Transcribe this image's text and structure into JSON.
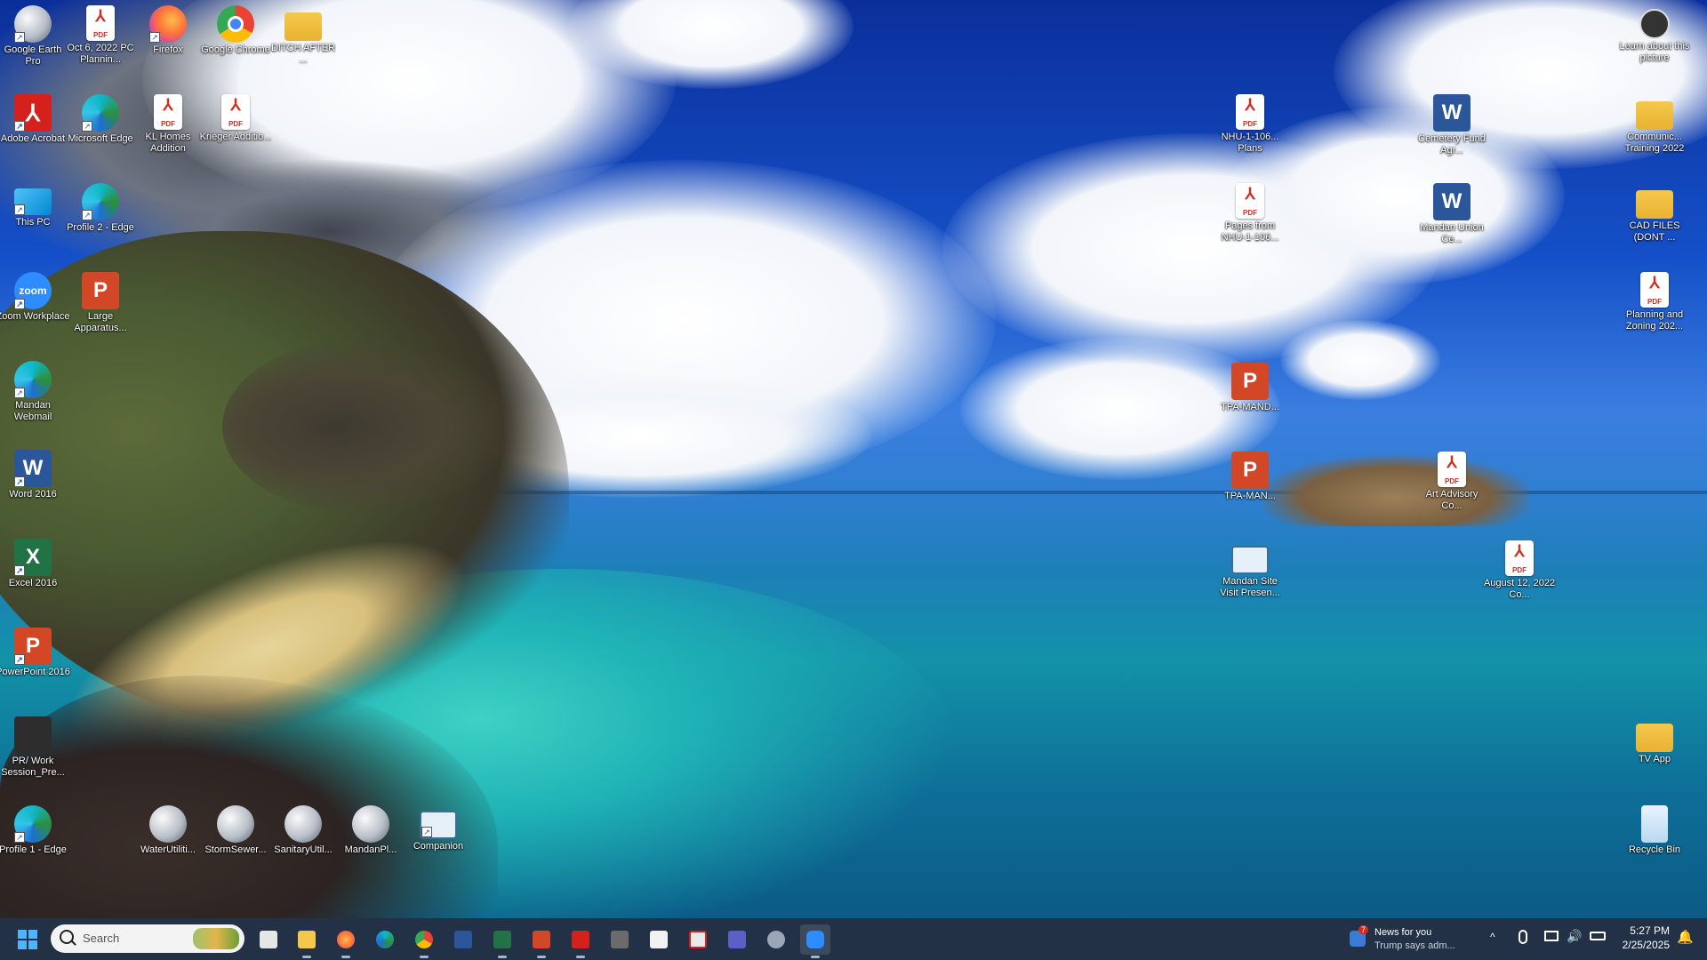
{
  "desktop_icons": {
    "col1": [
      {
        "label": "Google Earth Pro",
        "icon": "google-earth-icon"
      },
      {
        "label": "Adobe Acrobat",
        "icon": "acrobat-icon"
      },
      {
        "label": "This PC",
        "icon": "this-pc-icon"
      },
      {
        "label": "Zoom Workplace",
        "icon": "zoom-icon"
      },
      {
        "label": "Mandan Webmail",
        "icon": "edge-icon"
      },
      {
        "label": "Word 2016",
        "icon": "word-icon"
      },
      {
        "label": "Excel 2016",
        "icon": "excel-icon"
      },
      {
        "label": "PowerPoint 2016",
        "icon": "powerpoint-icon"
      },
      {
        "label": "PR/ Work Session_Pre...",
        "icon": "presentation-icon"
      },
      {
        "label": "Profile 1 - Edge",
        "icon": "edge-icon"
      }
    ],
    "col2": [
      {
        "label": "Oct 6, 2022 PC Plannin...",
        "icon": "pdf-icon"
      },
      {
        "label": "Microsoft Edge",
        "icon": "edge-icon"
      },
      {
        "label": "Profile 2 - Edge",
        "icon": "edge-icon"
      },
      {
        "label": "Large Apparatus...",
        "icon": "powerpoint-icon"
      }
    ],
    "col3": [
      {
        "label": "Firefox",
        "icon": "firefox-icon"
      },
      {
        "label": "KL Homes Addition",
        "icon": "pdf-icon"
      }
    ],
    "col4": [
      {
        "label": "Google Chrome",
        "icon": "chrome-icon"
      },
      {
        "label": "Krieger Additio...",
        "icon": "pdf-icon"
      }
    ],
    "col5": [
      {
        "label": "DITCH AFTER ...",
        "icon": "folder-icon"
      }
    ],
    "bottom_row": [
      {
        "label": "WaterUtiliti...",
        "icon": "google-earth-icon"
      },
      {
        "label": "StormSewer...",
        "icon": "google-earth-icon"
      },
      {
        "label": "SanitaryUtil...",
        "icon": "google-earth-icon"
      },
      {
        "label": "MandanPl...",
        "icon": "google-earth-icon"
      },
      {
        "label": "Companion",
        "icon": "companion-icon"
      }
    ],
    "right_a": [
      {
        "label": "NHU-1-106... Plans",
        "icon": "pdf-icon"
      },
      {
        "label": "Pages from NHU-1-106...",
        "icon": "pdf-icon"
      },
      {
        "label": "TPA-MAND...",
        "icon": "powerpoint-icon"
      },
      {
        "label": "TPA-MAN...",
        "icon": "powerpoint-icon"
      },
      {
        "label": "Mandan Site Visit Presen...",
        "icon": "presentation-icon"
      }
    ],
    "right_b": [
      {
        "label": "Cemetery Fund Agr...",
        "icon": "word-icon"
      },
      {
        "label": "Mandan Union Ce...",
        "icon": "word-icon"
      },
      {
        "label": "Art Advisory Co...",
        "icon": "pdf-icon"
      }
    ],
    "right_c": [
      {
        "label": "August 12, 2022 Co...",
        "icon": "pdf-icon"
      }
    ],
    "right_d": [
      {
        "label": "Learn about this picture",
        "icon": "info-icon"
      },
      {
        "label": "Communic... Training 2022",
        "icon": "folder-icon"
      },
      {
        "label": "CAD FILES (DONT ...",
        "icon": "folder-icon"
      },
      {
        "label": "Planning and Zoning 202...",
        "icon": "pdf-icon"
      },
      {
        "label": "TV App",
        "icon": "folder-icon"
      },
      {
        "label": "Recycle Bin",
        "icon": "recycle-bin-icon"
      }
    ]
  },
  "taskbar": {
    "search_placeholder": "Search",
    "apps": [
      "task-view-icon",
      "file-explorer-icon",
      "firefox-icon",
      "edge-icon",
      "chrome-icon",
      "word-icon",
      "excel-icon",
      "powerpoint-icon",
      "acrobat-icon",
      "presentation-icon",
      "notepad-icon",
      "snipping-icon",
      "teams-icon",
      "settings-icon",
      "zoom-icon"
    ],
    "news_badge": "7",
    "news_title": "News for you",
    "news_subtitle": "Trump says adm...",
    "time": "5:27 PM",
    "date": "2/25/2025"
  },
  "colors": {
    "taskbar": "#14243a",
    "pdf_red": "#d62a1c",
    "word_blue": "#2b579a",
    "excel_green": "#217346",
    "ppt_orange": "#d24726",
    "folder_yellow": "#f4c84b"
  }
}
